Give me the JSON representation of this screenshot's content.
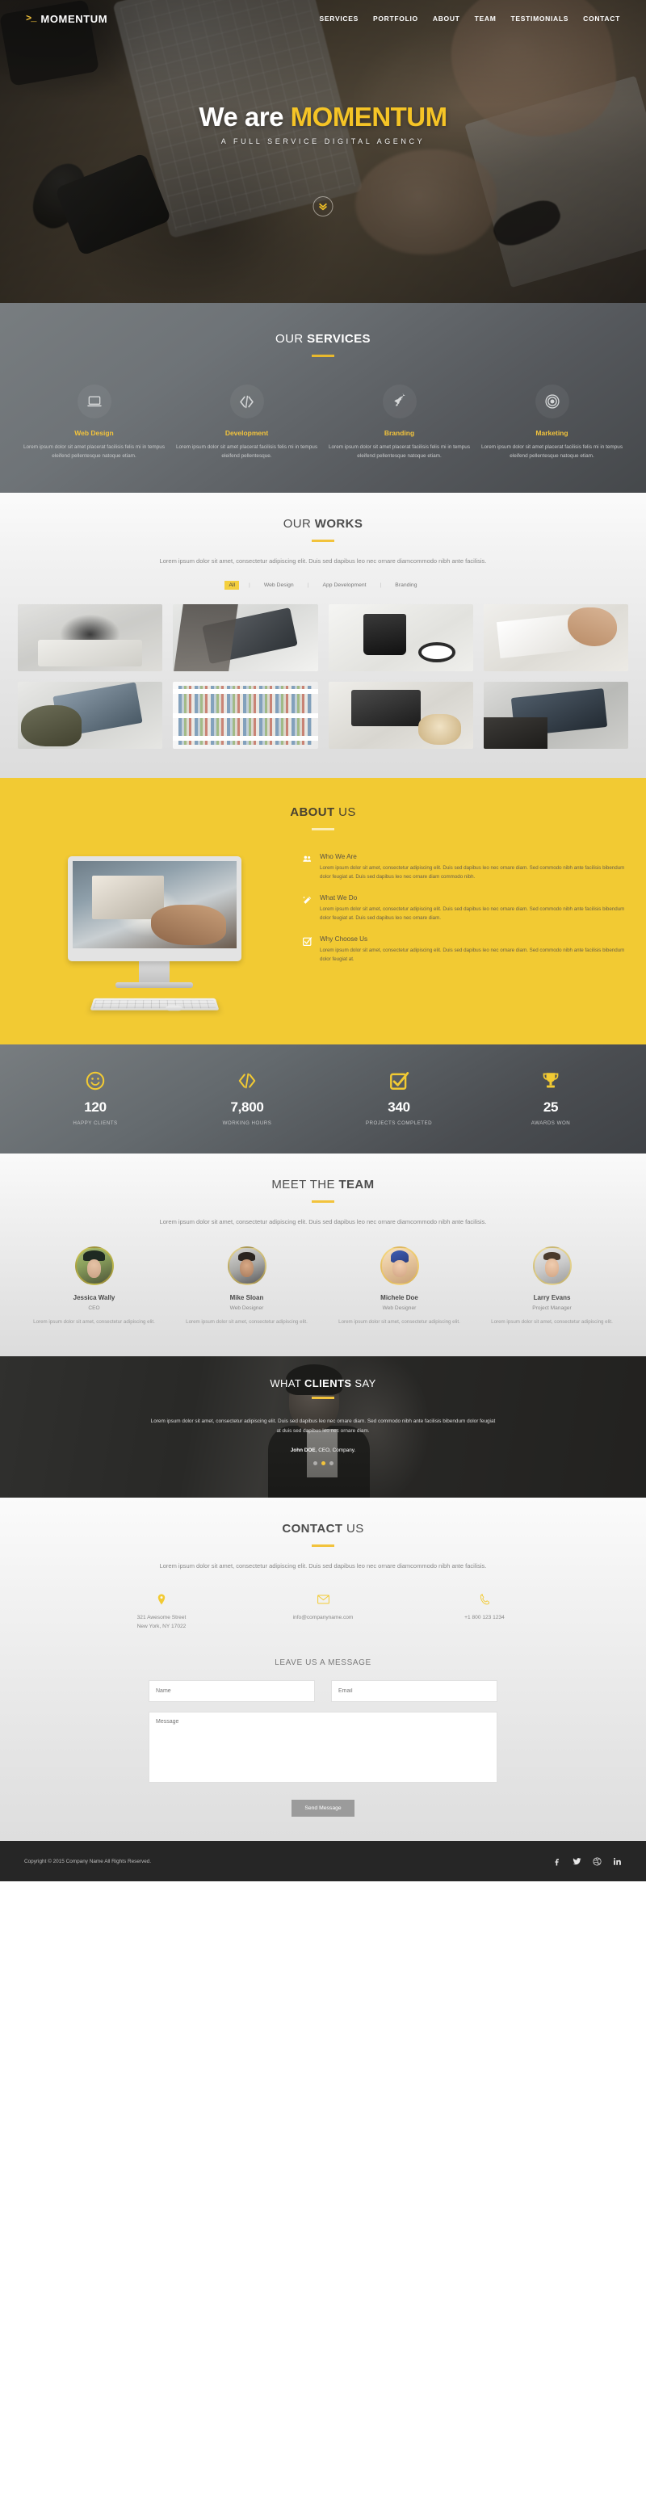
{
  "header": {
    "brand_mark": ">_",
    "brand": "MOMENTUM",
    "nav": [
      {
        "label": "SERVICES",
        "active": false
      },
      {
        "label": "PORTFOLIO",
        "active": false
      },
      {
        "label": "ABOUT",
        "active": false
      },
      {
        "label": "TEAM",
        "active": false
      },
      {
        "label": "TESTIMONIALS",
        "active": false
      },
      {
        "label": "CONTACT",
        "active": false
      }
    ]
  },
  "hero": {
    "title_plain": "We are ",
    "title_accent": "MOMENTUM",
    "subtitle": "A FULL SERVICE DIGITAL AGENCY",
    "scroll_icon": "double-chevron-down-icon"
  },
  "services": {
    "title_light": "OUR ",
    "title_bold": "SERVICES",
    "items": [
      {
        "icon": "laptop-icon",
        "name": "Web Design",
        "desc": "Lorem ipsum dolor sit amet placerat facilisis felis mi in tempus eleifend pellentesque natoque etiam."
      },
      {
        "icon": "code-icon",
        "name": "Development",
        "desc": "Lorem ipsum dolor sit amet placerat facilisis felis mi in tempus eleifend pellentesque."
      },
      {
        "icon": "rocket-icon",
        "name": "Branding",
        "desc": "Lorem ipsum dolor sit amet placerat facilisis felis mi in tempus eleifend pellentesque natoque etiam."
      },
      {
        "icon": "target-icon",
        "name": "Marketing",
        "desc": "Lorem ipsum dolor sit amet placerat facilisis felis mi in tempus eleifend pellentesque natoque etiam."
      }
    ]
  },
  "works": {
    "title_light": "OUR ",
    "title_bold": "WORKS",
    "lead": "Lorem ipsum dolor sit amet, consectetur adipiscing elit. Duis sed dapibus leo nec ornare diamcommodo nibh ante facilisis.",
    "filters": [
      {
        "label": "All",
        "active": true
      },
      {
        "label": "Web Design",
        "active": false
      },
      {
        "label": "App Development",
        "active": false
      },
      {
        "label": "Branding",
        "active": false
      }
    ],
    "separator": "|"
  },
  "about": {
    "title_bold": "ABOUT",
    "title_light": " US",
    "items": [
      {
        "icon": "users-icon",
        "head": "Who We Are",
        "text": "Lorem ipsum dolor sit amet, consectetur adipiscing elit. Duis sed dapibus leo nec ornare diam. Sed commodo nibh ante facilisis bibendum dolor feugiat at. Duis sed dapibus leo nec ornare diam commodo nibh."
      },
      {
        "icon": "magic-wand-icon",
        "head": "What We Do",
        "text": "Lorem ipsum dolor sit amet, consectetur adipiscing elit. Duis sed dapibus leo nec ornare diam. Sed commodo nibh ante facilisis bibendum dolor feugiat at. Duis sed dapibus leo nec ornare diam."
      },
      {
        "icon": "checkbox-icon",
        "head": "Why Choose Us",
        "text": "Lorem ipsum dolor sit amet, consectetur adipiscing elit. Duis sed dapibus leo nec ornare diam. Sed commodo nibh ante facilisis bibendum dolor feugiat at."
      }
    ]
  },
  "stats": [
    {
      "icon": "smiley-icon",
      "value": "120",
      "label": "HAPPY CLIENTS"
    },
    {
      "icon": "code-icon",
      "value": "7,800",
      "label": "WORKING HOURS"
    },
    {
      "icon": "check-square-icon",
      "value": "340",
      "label": "PROJECTS COMPLETED"
    },
    {
      "icon": "trophy-icon",
      "value": "25",
      "label": "AWARDS WON"
    }
  ],
  "team": {
    "title_light": "MEET THE ",
    "title_bold": "TEAM",
    "lead": "Lorem ipsum dolor sit amet, consectetur adipiscing elit. Duis sed dapibus leo nec ornare diamcommodo nibh ante facilisis.",
    "members": [
      {
        "name": "Jessica Wally",
        "role": "CEO",
        "text": "Lorem ipsum dolor sit amet, consectetur adipiscing elit."
      },
      {
        "name": "Mike Sloan",
        "role": "Web Designer",
        "text": "Lorem ipsum dolor sit amet, consectetur adipiscing elit."
      },
      {
        "name": "Michele Doe",
        "role": "Web Designer",
        "text": "Lorem ipsum dolor sit amet, consectetur adipiscing elit."
      },
      {
        "name": "Larry Evans",
        "role": "Project Manager",
        "text": "Lorem ipsum dolor sit amet, consectetur adipiscing elit."
      }
    ]
  },
  "testimonials": {
    "title_light": "WHAT ",
    "title_bold": "CLIENTS",
    "title_light2": " SAY",
    "quote": "Lorem ipsum dolor sit amet, consectetur adipiscing elit. Duis sed dapibus leo nec ornare diam. Sed commodo nibh ante facilisis bibendum dolor feugiat at duis sed dapibus leo nec ornare diam.",
    "author_name": "John DOE",
    "author_meta": ", CEO, Company.",
    "slide_count": 3,
    "active_slide": 2
  },
  "contact": {
    "title_bold": "CONTACT",
    "title_light": " US",
    "lead": "Lorem ipsum dolor sit amet, consectetur adipiscing elit. Duis sed dapibus leo nec ornare diamcommodo nibh ante facilisis.",
    "info": [
      {
        "icon": "map-pin-icon",
        "line1": "321 Awesome Street",
        "line2": "New York, NY 17022"
      },
      {
        "icon": "envelope-icon",
        "line1": "info@companyname.com",
        "line2": ""
      },
      {
        "icon": "phone-icon",
        "line1": "+1 800 123 1234",
        "line2": ""
      }
    ],
    "form": {
      "heading": "LEAVE US A MESSAGE",
      "name_placeholder": "Name",
      "name_value": "",
      "email_placeholder": "Email",
      "email_value": "",
      "message_placeholder": "Message",
      "message_value": "",
      "submit_label": "Send Message"
    }
  },
  "footer": {
    "copyright": "Copyright © 2015 Company Name All Rights Reserved.",
    "socials": [
      "facebook-icon",
      "twitter-icon",
      "dribbble-icon",
      "linkedin-icon"
    ]
  },
  "colors": {
    "accent": "#f2ca33",
    "accent_text": "#f2c33c",
    "dark": "#262626",
    "slate": "#5a5e62"
  }
}
